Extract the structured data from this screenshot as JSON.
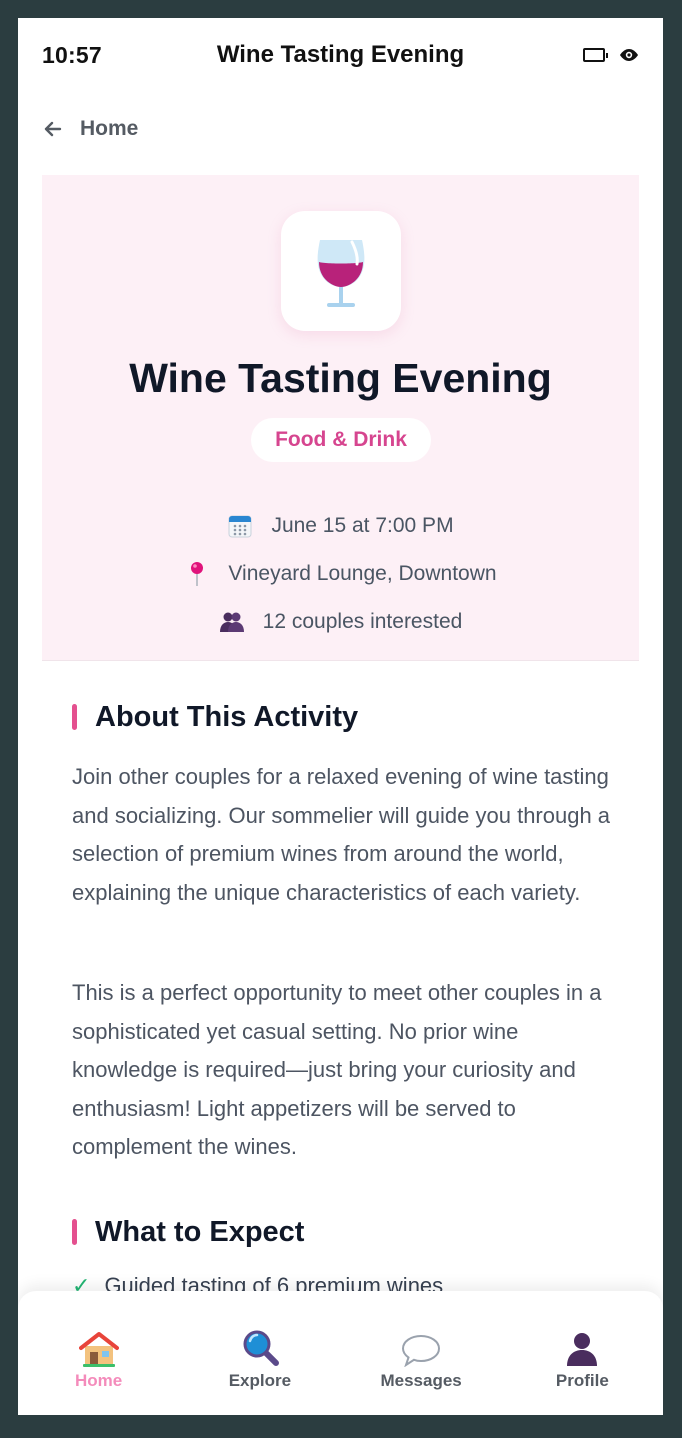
{
  "status_bar": {
    "time": "10:57",
    "title": "Wine Tasting Evening",
    "icons": [
      "battery-icon",
      "eye-icon"
    ]
  },
  "back_nav": {
    "label": "Home",
    "icon": "arrow-left-icon"
  },
  "hero": {
    "icon": "wine-glass-icon",
    "title": "Wine Tasting Evening",
    "category": "Food & Drink",
    "date": "June 15 at 7:00 PM",
    "location": "Vineyard Lounge, Downtown",
    "interest": "12 couples interested"
  },
  "about": {
    "heading": "About This Activity",
    "paragraph_1": "Join other couples for a relaxed evening of wine tasting and socializing. Our sommelier will guide you through a selection of premium wines from around the world, explaining the unique characteristics of each variety.",
    "paragraph_2": "This is a perfect opportunity to meet other couples in a sophisticated yet casual setting. No prior wine knowledge is required—just bring your curiosity and enthusiasm! Light appetizers will be served to complement the wines."
  },
  "expect": {
    "heading": "What to Expect",
    "items": [
      {
        "check": "✓",
        "text": "Guided tasting of 6 premium wines"
      }
    ]
  },
  "bottom_nav": {
    "items": [
      {
        "label": "Home",
        "icon": "house-icon",
        "active": true
      },
      {
        "label": "Explore",
        "icon": "magnifier-icon",
        "active": false
      },
      {
        "label": "Messages",
        "icon": "speech-bubble-icon",
        "active": false
      },
      {
        "label": "Profile",
        "icon": "person-silhouette-icon",
        "active": false
      }
    ]
  },
  "colors": {
    "accent": "#e4508f",
    "category_text": "#d6458f",
    "hero_background": "#fdf0f6",
    "active_nav": "#f48bbb",
    "check": "#22b573",
    "outer_background": "#2b3d40"
  }
}
